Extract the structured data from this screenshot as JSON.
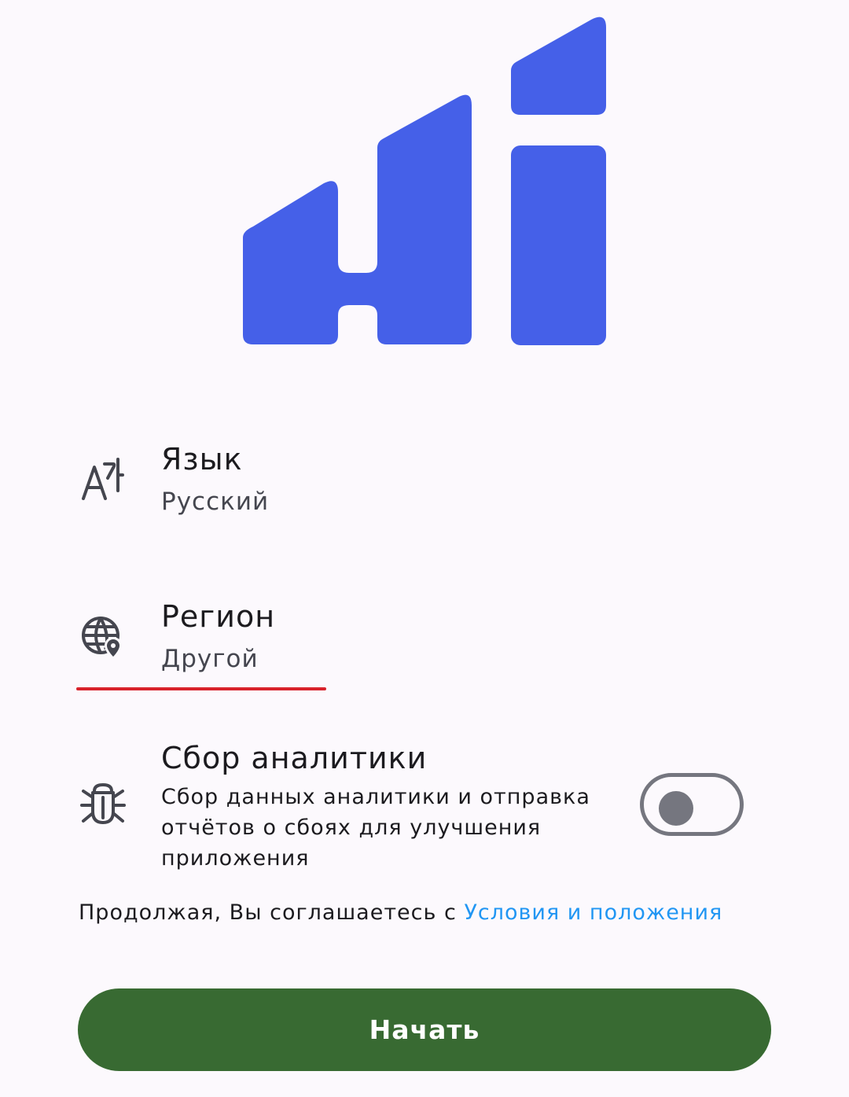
{
  "colors": {
    "background": "#fcf9fd",
    "logo": "#4560e8",
    "accent_underline": "#d8222b",
    "link": "#2196f3",
    "button": "#386a32",
    "toggle_off": "#75767f"
  },
  "logo": {
    "icon": "hi-logo-icon"
  },
  "settings": {
    "language": {
      "icon": "translate-icon",
      "title": "Язык",
      "value": "Русский"
    },
    "region": {
      "icon": "globe-location-icon",
      "title": "Регион",
      "value": "Другой"
    },
    "analytics": {
      "icon": "bug-icon",
      "title": "Сбор аналитики",
      "description": "Сбор данных аналитики и отправка отчётов о сбоях для улучшения приложения",
      "enabled": false
    }
  },
  "terms": {
    "prefix": "Продолжая, Вы соглашаетесь с ",
    "link_label": "Условия и положения"
  },
  "start_button": {
    "label": "Начать"
  }
}
